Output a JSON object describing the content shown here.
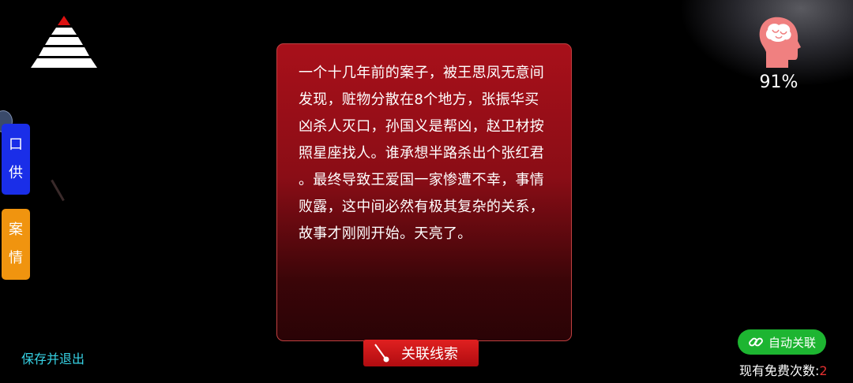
{
  "brain_meter": {
    "percent_label": "91%"
  },
  "side_tabs": [
    {
      "chars": [
        "口",
        "供"
      ]
    },
    {
      "chars": [
        "案",
        "情"
      ]
    }
  ],
  "card": {
    "lines": [
      "一个十几年前的案子，被王思凤无意间",
      "发现，赃物分散在8个地方，张振华买",
      "凶杀人灭口，孙国义是帮凶，赵卫材按",
      "照星座找人。谁承想半路杀出个张红君",
      "。最终导致王爱国一家惨遭不幸，事情",
      "败露，这中间必然有极其复杂的关系，",
      "故事才刚刚开始。天亮了。"
    ]
  },
  "buttons": {
    "clue_link": "关联线索",
    "save_exit": "保存并退出",
    "auto_link": "自动关联"
  },
  "free_count": {
    "label": "现有免费次数:",
    "value": "2"
  },
  "colors": {
    "card_red": "#a8101a",
    "tab_blue": "#1a2ee8",
    "tab_orange": "#f0940f",
    "auto_green": "#1db531",
    "save_cyan": "#37d3e6",
    "count_red": "#e23030"
  }
}
